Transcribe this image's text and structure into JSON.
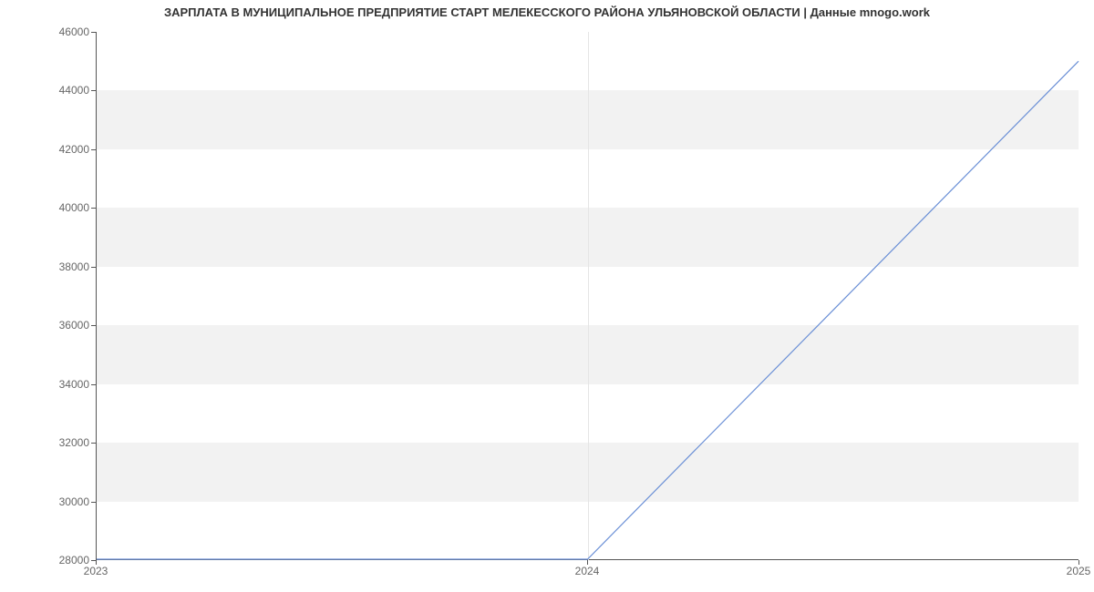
{
  "chart_data": {
    "type": "line",
    "title": "ЗАРПЛАТА В МУНИЦИПАЛЬНОЕ ПРЕДПРИЯТИЕ СТАРТ МЕЛЕКЕССКОГО РАЙОНА УЛЬЯНОВСКОЙ ОБЛАСТИ | Данные mnogo.work",
    "x": [
      2023,
      2024,
      2025
    ],
    "values": [
      28000,
      28000,
      45000
    ],
    "xlabel": "",
    "ylabel": "",
    "xlim": [
      2023,
      2025
    ],
    "ylim": [
      28000,
      46000
    ],
    "x_ticks": [
      2023,
      2024,
      2025
    ],
    "y_ticks": [
      28000,
      30000,
      32000,
      34000,
      36000,
      38000,
      40000,
      42000,
      44000,
      46000
    ],
    "line_color": "#6a8fd6",
    "band_color": "#f2f2f2"
  }
}
